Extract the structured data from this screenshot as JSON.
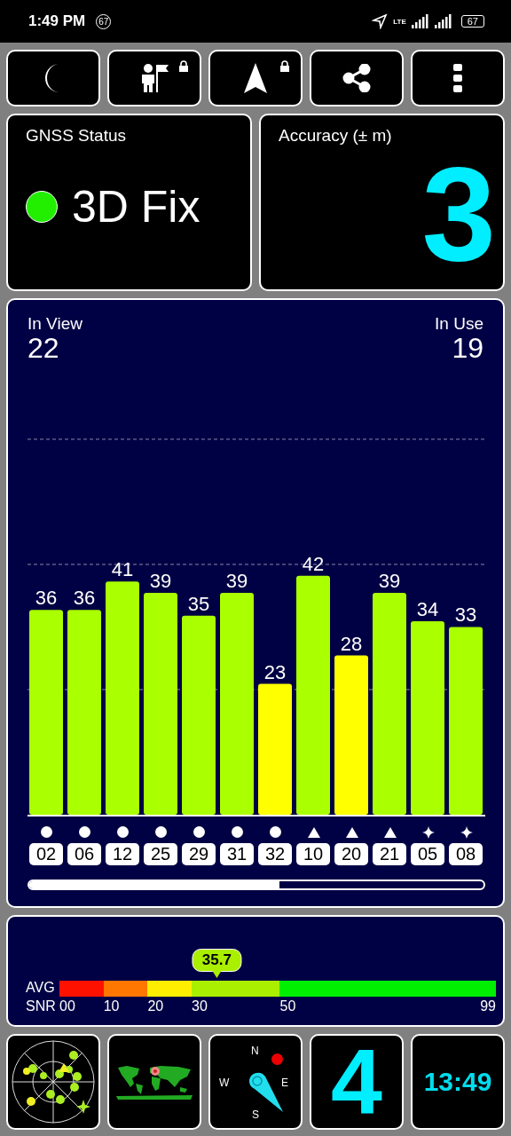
{
  "status_bar": {
    "time": "1:49 PM",
    "notification_badge": "67",
    "network": "LTE",
    "battery": "67"
  },
  "toolbar": [
    {
      "kind": "moon",
      "locked": false
    },
    {
      "kind": "person-flag",
      "locked": true
    },
    {
      "kind": "arrow",
      "locked": true
    },
    {
      "kind": "share",
      "locked": false
    },
    {
      "kind": "more",
      "locked": false
    }
  ],
  "gnss_status": {
    "title": "GNSS Status",
    "value": "3D Fix",
    "color": "#22ee00"
  },
  "accuracy": {
    "title": "Accuracy (± m)",
    "value": "3"
  },
  "satellites": {
    "in_view_label": "In View",
    "in_view": "22",
    "in_use_label": "In Use",
    "in_use": "19",
    "chart_data": {
      "type": "bar",
      "categories": [
        "02",
        "06",
        "12",
        "25",
        "29",
        "31",
        "32",
        "10",
        "20",
        "21",
        "05",
        "08"
      ],
      "values": [
        36,
        36,
        41,
        39,
        35,
        39,
        23,
        42,
        28,
        39,
        34,
        33
      ],
      "data_labels": true
    },
    "marks": [
      {
        "kind": "circle"
      },
      {
        "kind": "circle"
      },
      {
        "kind": "circle"
      },
      {
        "kind": "circle"
      },
      {
        "kind": "circle"
      },
      {
        "kind": "circle"
      },
      {
        "kind": "circle"
      },
      {
        "kind": "triangle"
      },
      {
        "kind": "triangle"
      },
      {
        "kind": "triangle"
      },
      {
        "kind": "star"
      },
      {
        "kind": "star"
      }
    ]
  },
  "snr": {
    "label_1": "AVG",
    "label_2": "SNR",
    "value": "35.7",
    "scale": [
      "00",
      "10",
      "20",
      "30",
      "50",
      "99"
    ],
    "segments": [
      {
        "color": "#ff1100"
      },
      {
        "color": "#ff7700"
      },
      {
        "color": "#ffee00"
      },
      {
        "color": "#aaee00"
      },
      {
        "color": "#00ee00"
      }
    ]
  },
  "bottom_tiles": {
    "compass": {
      "n": "N",
      "e": "E",
      "s": "S",
      "w": "W"
    },
    "count": "4",
    "clock": "13:49"
  }
}
